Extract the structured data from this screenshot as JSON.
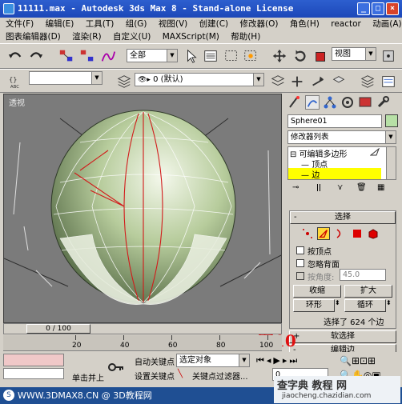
{
  "window": {
    "title": "11111.max - Autodesk 3ds Max 8 - Stand-alone License",
    "min": "_",
    "max": "□",
    "close": "×"
  },
  "menu1": [
    "文件(F)",
    "编辑(E)",
    "工具(T)",
    "组(G)",
    "视图(V)",
    "创建(C)",
    "修改器(O)",
    "角色(H)",
    "reactor",
    "动画(A)"
  ],
  "menu2": [
    "图表编辑器(D)",
    "渲染(R)",
    "自定义(U)",
    "MAXScript(M)",
    "帮助(H)"
  ],
  "toolbar": {
    "selection_filter": "全部",
    "ref_coord": "视图",
    "layer_label": "0 (默认)"
  },
  "viewport": {
    "label": "透视"
  },
  "panel": {
    "object_name": "Sphere01",
    "modifier_list": "修改器列表",
    "stack": [
      "可编辑多边形",
      "顶点",
      "边"
    ],
    "selection_title": "选择",
    "by_vertex": "按顶点",
    "ignore_backface": "忽略背面",
    "by_angle": "按角度:",
    "angle_value": "45.0",
    "shrink": "收缩",
    "grow": "扩大",
    "ring": "环形",
    "loop": "循环",
    "selected_count": "选择了 624 个边",
    "soft_selection": "软选择",
    "edit_edges": "编辑边"
  },
  "timeline": {
    "frame_display": "0 / 100",
    "ticks": [
      "20",
      "40",
      "60",
      "80",
      "100"
    ]
  },
  "bottom": {
    "auto_key": "自动关键点",
    "key_mode": "选定对象",
    "set_key": "设置关键点",
    "key_filters": "关键点过滤器...",
    "click_add": "单击并上",
    "frame_field": "0"
  },
  "annotation": "图10",
  "watermark": {
    "left": "WWW.3DMAX8.CN @ 3D教程网",
    "right_top": "查字典 教程 网",
    "right_bottom": "jiaocheng.chazidian.com"
  },
  "colors": {
    "title_blue": "#2458c8",
    "viewport": "#7b7b7b",
    "highlight": "#ffff00",
    "annotation": "#e01010"
  }
}
